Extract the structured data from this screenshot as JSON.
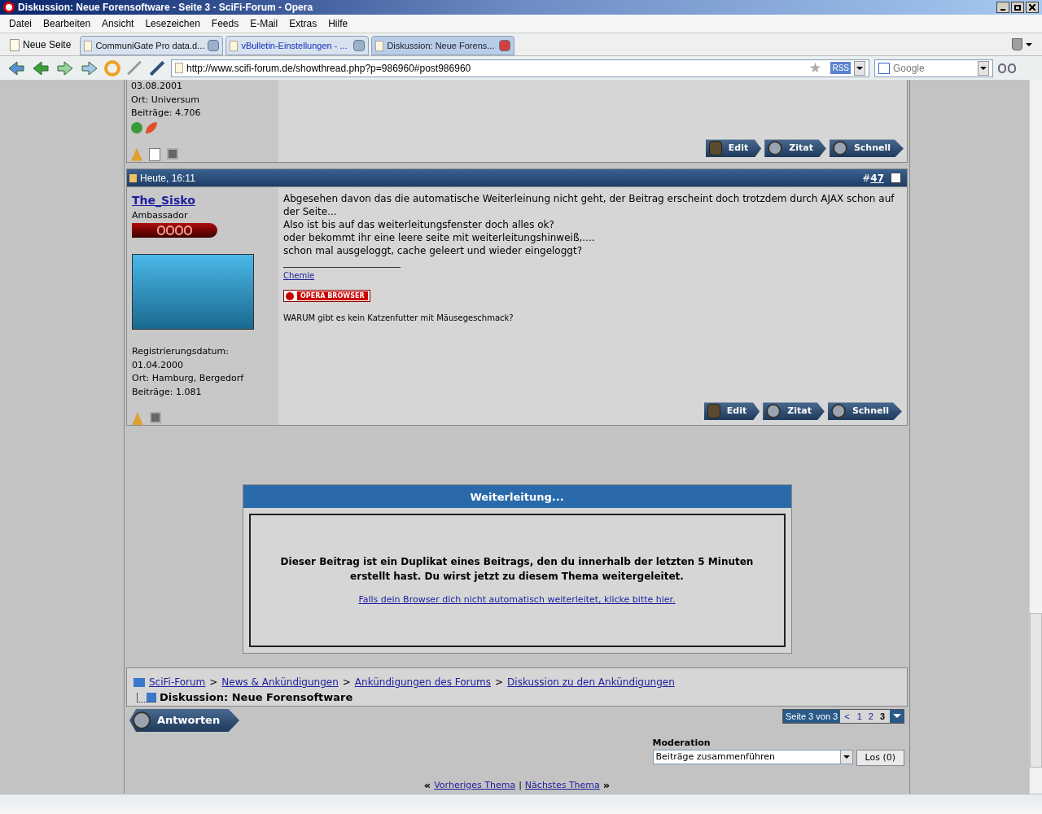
{
  "window": {
    "title": "Diskussion: Neue Forensoftware - Seite 3 - SciFi-Forum - Opera"
  },
  "menu": [
    "Datei",
    "Bearbeiten",
    "Ansicht",
    "Lesezeichen",
    "Feeds",
    "E-Mail",
    "Extras",
    "Hilfe"
  ],
  "new_tab": "Neue Seite",
  "tabs": [
    {
      "label": "CommuniGate Pro data.d...",
      "selected": false
    },
    {
      "label": "vBulletin-Einstellungen - ...",
      "selected": false
    },
    {
      "label": "Diskussion: Neue Forens...",
      "selected": true
    }
  ],
  "address": {
    "url": "http://www.scifi-forum.de/showthread.php?p=986960#post986960",
    "feed_badge": "RSS"
  },
  "search": {
    "placeholder": "Google"
  },
  "previous_post": {
    "details": [
      "03.08.2001",
      "Ort: Universum",
      "Beiträge: 4.706"
    ],
    "buttons": [
      "Edit",
      "Zitat",
      "Schnell"
    ]
  },
  "post": {
    "date": "Heute, 16:11",
    "number_prefix": "#",
    "number": "47",
    "checked": false,
    "username": "The_Sisko",
    "rank": "Ambassador",
    "details": [
      "Registrierungsdatum:",
      "01.04.2000",
      "Ort: Hamburg, Bergedorf",
      "Beiträge: 1.081"
    ],
    "message": [
      "Abgesehen davon das die automatische Weiterleinung nicht geht, der Beitrag erscheint doch trotzdem durch AJAX schon auf der Seite...",
      "Also ist bis auf das weiterleitungsfenster doch alles ok?",
      "oder bekommt ihr eine leere seite mit weiterleitungshinweiß,....",
      "schon mal ausgeloggt, cache geleert und wieder eingeloggt?"
    ],
    "signature_link": "Chemie",
    "signature_badge": "OPERA BROWSER",
    "signature_text": "WARUM gibt es kein Katzenfutter mit Mäusegeschmack?",
    "buttons": [
      "Edit",
      "Zitat",
      "Schnell"
    ]
  },
  "dialog": {
    "title": "Weiterleitung...",
    "message": "Dieser Beitrag ist ein Duplikat eines Beitrags, den du innerhalb der letzten 5 Minuten erstellt hast. Du wirst jetzt zu diesem Thema weitergeleitet.",
    "link": "Falls dein Browser dich nicht automatisch weiterleitet, klicke bitte hier."
  },
  "breadcrumb": {
    "items": [
      "SciFi-Forum",
      "News & Ankündigungen",
      "Ankündigungen des Forums",
      "Diskussion zu den Ankündigungen"
    ],
    "separator": ">",
    "current": "Diskussion: Neue Forensoftware"
  },
  "reply_button": "Antworten",
  "pagination": {
    "label": "Seite 3 von 3",
    "prev": "<",
    "pages": [
      {
        "label": "1",
        "selected": false
      },
      {
        "label": "2",
        "selected": false
      },
      {
        "label": "3",
        "selected": true
      }
    ]
  },
  "moderation": {
    "label": "Moderation",
    "value": "Beiträge zusammenführen",
    "button": "Los (0)"
  },
  "thread_nav": {
    "left_mark": "«",
    "prev": "Vorheriges Thema",
    "separator": "|",
    "next": "Nächstes Thema",
    "right_mark": "»"
  }
}
